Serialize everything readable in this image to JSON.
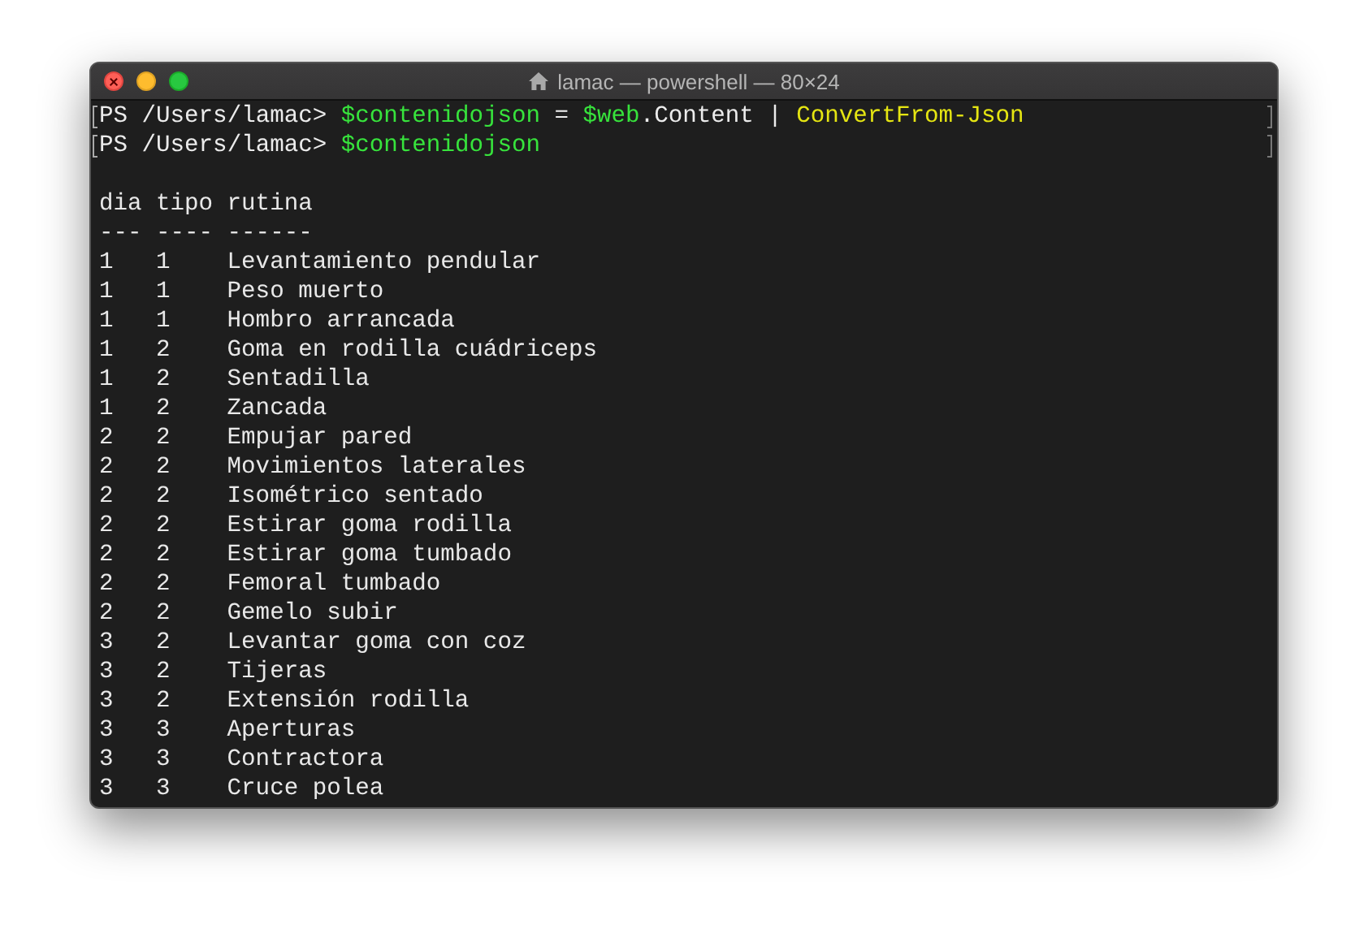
{
  "window": {
    "title": "lamac — powershell — 80×24"
  },
  "prompt_lines": [
    {
      "marked": true,
      "segments": [
        {
          "kind": "plain",
          "text": "PS /Users/lamac> "
        },
        {
          "kind": "variable",
          "text": "$contenidojson"
        },
        {
          "kind": "plain",
          "text": " = "
        },
        {
          "kind": "variable",
          "text": "$web"
        },
        {
          "kind": "plain",
          "text": ".Content | "
        },
        {
          "kind": "command",
          "text": "ConvertFrom-Json"
        }
      ]
    },
    {
      "marked": true,
      "segments": [
        {
          "kind": "plain",
          "text": "PS /Users/lamac> "
        },
        {
          "kind": "variable",
          "text": "$contenidojson"
        }
      ]
    }
  ],
  "table": {
    "columns": [
      "dia",
      "tipo",
      "rutina"
    ],
    "rules": [
      "---",
      "----",
      "------"
    ],
    "rows": [
      [
        "1",
        "1",
        "Levantamiento pendular"
      ],
      [
        "1",
        "1",
        "Peso muerto"
      ],
      [
        "1",
        "1",
        "Hombro arrancada"
      ],
      [
        "1",
        "2",
        "Goma en rodilla cuádriceps"
      ],
      [
        "1",
        "2",
        "Sentadilla"
      ],
      [
        "1",
        "2",
        "Zancada"
      ],
      [
        "2",
        "2",
        "Empujar pared"
      ],
      [
        "2",
        "2",
        "Movimientos laterales"
      ],
      [
        "2",
        "2",
        "Isométrico sentado"
      ],
      [
        "2",
        "2",
        "Estirar goma rodilla"
      ],
      [
        "2",
        "2",
        "Estirar goma tumbado"
      ],
      [
        "2",
        "2",
        "Femoral tumbado"
      ],
      [
        "2",
        "2",
        "Gemelo subir"
      ],
      [
        "3",
        "2",
        "Levantar goma con coz"
      ],
      [
        "3",
        "2",
        "Tijeras"
      ],
      [
        "3",
        "2",
        "Extensión rodilla"
      ],
      [
        "3",
        "3",
        "Aperturas"
      ],
      [
        "3",
        "3",
        "Contractora"
      ],
      [
        "3",
        "3",
        "Cruce polea"
      ]
    ]
  }
}
